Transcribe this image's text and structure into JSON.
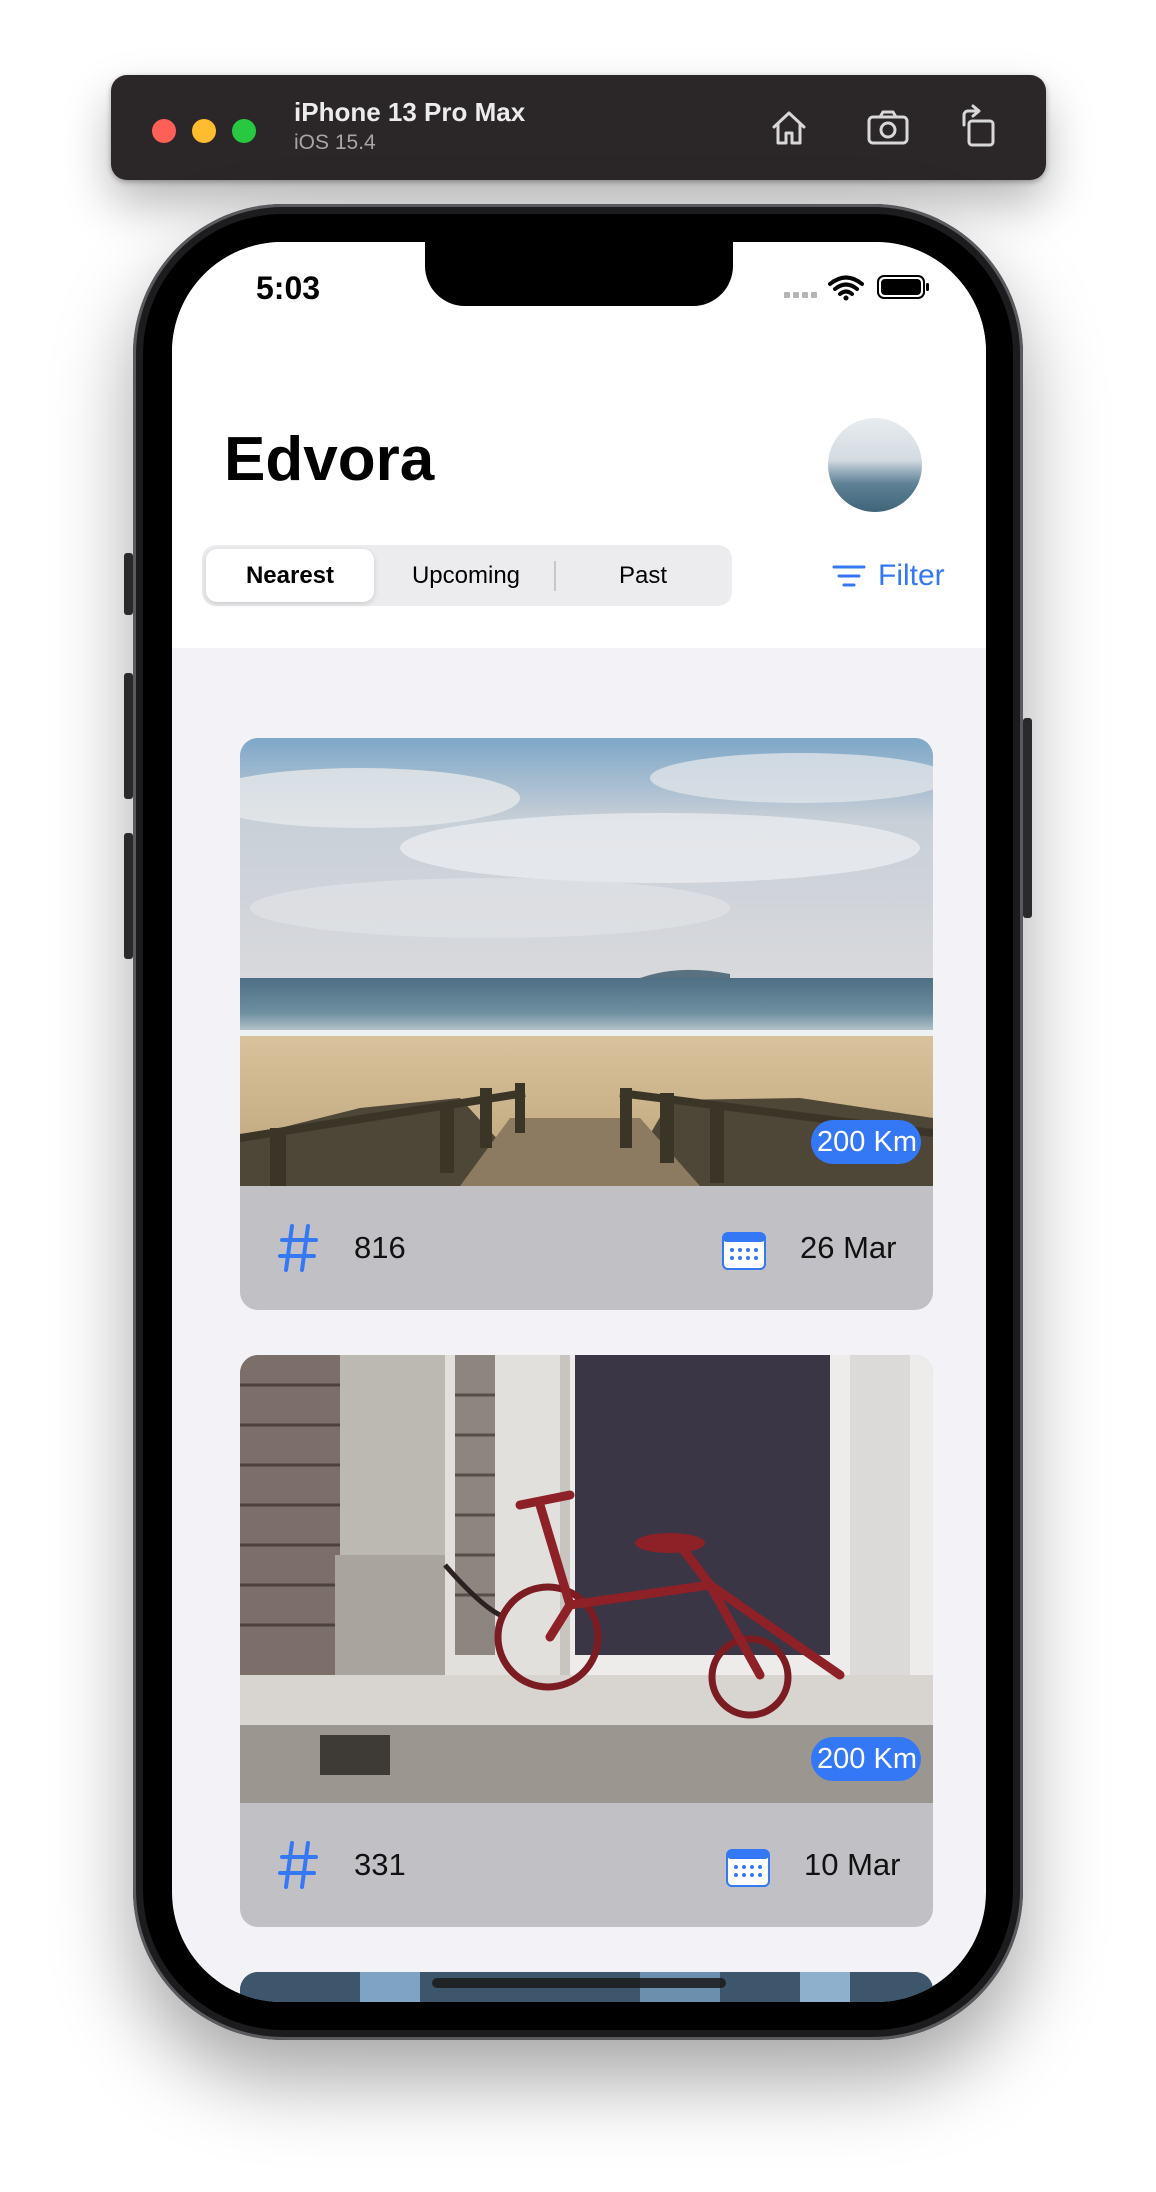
{
  "simulator": {
    "device_name": "iPhone 13 Pro Max",
    "os_version": "iOS 15.4",
    "icons": [
      "home-icon",
      "screenshot-icon",
      "rotate-icon"
    ]
  },
  "status_bar": {
    "time": "5:03",
    "icons": [
      "cellular-icon",
      "wifi-icon",
      "battery-icon"
    ]
  },
  "header": {
    "title": "Edvora",
    "avatar_icon": "profile-avatar"
  },
  "tabs": [
    {
      "label": "Nearest",
      "active": true
    },
    {
      "label": "Upcoming",
      "active": false
    },
    {
      "label": "Past",
      "active": false
    }
  ],
  "filter": {
    "label": "Filter",
    "icon": "filter-lines-icon"
  },
  "cards": [
    {
      "image": "beach-boardwalk-photo",
      "distance": "200 Km",
      "number": "816",
      "date": "26 Mar"
    },
    {
      "image": "red-tricycle-photo",
      "distance": "200 Km",
      "number": "331",
      "date": "10 Mar"
    }
  ],
  "colors": {
    "accent": "#3478f6",
    "card_footer": "#c0c0c5",
    "page_background": "#f2f2f7"
  }
}
